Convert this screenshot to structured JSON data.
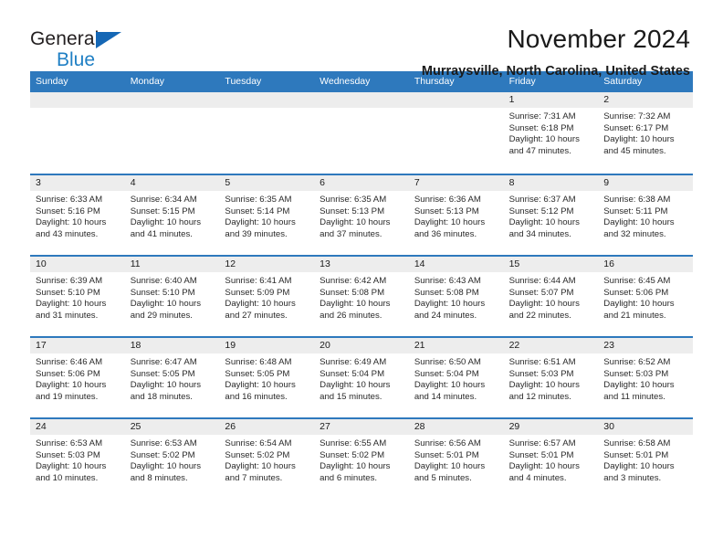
{
  "brand": {
    "line1": "General",
    "line2": "Blue",
    "triangle_color": "#1567b5",
    "blue_text_color": "#1f7fc4"
  },
  "header": {
    "title": "November 2024",
    "subtitle": "Murraysville, North Carolina, United States"
  },
  "theme": {
    "header_band_color": "#2e79bd",
    "day_band_color": "#ededed",
    "text_color": "#1a1a1a"
  },
  "weekdays": [
    "Sunday",
    "Monday",
    "Tuesday",
    "Wednesday",
    "Thursday",
    "Friday",
    "Saturday"
  ],
  "weeks": [
    [
      {
        "day": "",
        "empty": true,
        "sunrise": "",
        "sunset": "",
        "daylight_line1": "",
        "daylight_line2": ""
      },
      {
        "day": "",
        "empty": true,
        "sunrise": "",
        "sunset": "",
        "daylight_line1": "",
        "daylight_line2": ""
      },
      {
        "day": "",
        "empty": true,
        "sunrise": "",
        "sunset": "",
        "daylight_line1": "",
        "daylight_line2": ""
      },
      {
        "day": "",
        "empty": true,
        "sunrise": "",
        "sunset": "",
        "daylight_line1": "",
        "daylight_line2": ""
      },
      {
        "day": "",
        "empty": true,
        "sunrise": "",
        "sunset": "",
        "daylight_line1": "",
        "daylight_line2": ""
      },
      {
        "day": "1",
        "empty": false,
        "sunrise": "Sunrise: 7:31 AM",
        "sunset": "Sunset: 6:18 PM",
        "daylight_line1": "Daylight: 10 hours",
        "daylight_line2": "and 47 minutes."
      },
      {
        "day": "2",
        "empty": false,
        "sunrise": "Sunrise: 7:32 AM",
        "sunset": "Sunset: 6:17 PM",
        "daylight_line1": "Daylight: 10 hours",
        "daylight_line2": "and 45 minutes."
      }
    ],
    [
      {
        "day": "3",
        "empty": false,
        "sunrise": "Sunrise: 6:33 AM",
        "sunset": "Sunset: 5:16 PM",
        "daylight_line1": "Daylight: 10 hours",
        "daylight_line2": "and 43 minutes."
      },
      {
        "day": "4",
        "empty": false,
        "sunrise": "Sunrise: 6:34 AM",
        "sunset": "Sunset: 5:15 PM",
        "daylight_line1": "Daylight: 10 hours",
        "daylight_line2": "and 41 minutes."
      },
      {
        "day": "5",
        "empty": false,
        "sunrise": "Sunrise: 6:35 AM",
        "sunset": "Sunset: 5:14 PM",
        "daylight_line1": "Daylight: 10 hours",
        "daylight_line2": "and 39 minutes."
      },
      {
        "day": "6",
        "empty": false,
        "sunrise": "Sunrise: 6:35 AM",
        "sunset": "Sunset: 5:13 PM",
        "daylight_line1": "Daylight: 10 hours",
        "daylight_line2": "and 37 minutes."
      },
      {
        "day": "7",
        "empty": false,
        "sunrise": "Sunrise: 6:36 AM",
        "sunset": "Sunset: 5:13 PM",
        "daylight_line1": "Daylight: 10 hours",
        "daylight_line2": "and 36 minutes."
      },
      {
        "day": "8",
        "empty": false,
        "sunrise": "Sunrise: 6:37 AM",
        "sunset": "Sunset: 5:12 PM",
        "daylight_line1": "Daylight: 10 hours",
        "daylight_line2": "and 34 minutes."
      },
      {
        "day": "9",
        "empty": false,
        "sunrise": "Sunrise: 6:38 AM",
        "sunset": "Sunset: 5:11 PM",
        "daylight_line1": "Daylight: 10 hours",
        "daylight_line2": "and 32 minutes."
      }
    ],
    [
      {
        "day": "10",
        "empty": false,
        "sunrise": "Sunrise: 6:39 AM",
        "sunset": "Sunset: 5:10 PM",
        "daylight_line1": "Daylight: 10 hours",
        "daylight_line2": "and 31 minutes."
      },
      {
        "day": "11",
        "empty": false,
        "sunrise": "Sunrise: 6:40 AM",
        "sunset": "Sunset: 5:10 PM",
        "daylight_line1": "Daylight: 10 hours",
        "daylight_line2": "and 29 minutes."
      },
      {
        "day": "12",
        "empty": false,
        "sunrise": "Sunrise: 6:41 AM",
        "sunset": "Sunset: 5:09 PM",
        "daylight_line1": "Daylight: 10 hours",
        "daylight_line2": "and 27 minutes."
      },
      {
        "day": "13",
        "empty": false,
        "sunrise": "Sunrise: 6:42 AM",
        "sunset": "Sunset: 5:08 PM",
        "daylight_line1": "Daylight: 10 hours",
        "daylight_line2": "and 26 minutes."
      },
      {
        "day": "14",
        "empty": false,
        "sunrise": "Sunrise: 6:43 AM",
        "sunset": "Sunset: 5:08 PM",
        "daylight_line1": "Daylight: 10 hours",
        "daylight_line2": "and 24 minutes."
      },
      {
        "day": "15",
        "empty": false,
        "sunrise": "Sunrise: 6:44 AM",
        "sunset": "Sunset: 5:07 PM",
        "daylight_line1": "Daylight: 10 hours",
        "daylight_line2": "and 22 minutes."
      },
      {
        "day": "16",
        "empty": false,
        "sunrise": "Sunrise: 6:45 AM",
        "sunset": "Sunset: 5:06 PM",
        "daylight_line1": "Daylight: 10 hours",
        "daylight_line2": "and 21 minutes."
      }
    ],
    [
      {
        "day": "17",
        "empty": false,
        "sunrise": "Sunrise: 6:46 AM",
        "sunset": "Sunset: 5:06 PM",
        "daylight_line1": "Daylight: 10 hours",
        "daylight_line2": "and 19 minutes."
      },
      {
        "day": "18",
        "empty": false,
        "sunrise": "Sunrise: 6:47 AM",
        "sunset": "Sunset: 5:05 PM",
        "daylight_line1": "Daylight: 10 hours",
        "daylight_line2": "and 18 minutes."
      },
      {
        "day": "19",
        "empty": false,
        "sunrise": "Sunrise: 6:48 AM",
        "sunset": "Sunset: 5:05 PM",
        "daylight_line1": "Daylight: 10 hours",
        "daylight_line2": "and 16 minutes."
      },
      {
        "day": "20",
        "empty": false,
        "sunrise": "Sunrise: 6:49 AM",
        "sunset": "Sunset: 5:04 PM",
        "daylight_line1": "Daylight: 10 hours",
        "daylight_line2": "and 15 minutes."
      },
      {
        "day": "21",
        "empty": false,
        "sunrise": "Sunrise: 6:50 AM",
        "sunset": "Sunset: 5:04 PM",
        "daylight_line1": "Daylight: 10 hours",
        "daylight_line2": "and 14 minutes."
      },
      {
        "day": "22",
        "empty": false,
        "sunrise": "Sunrise: 6:51 AM",
        "sunset": "Sunset: 5:03 PM",
        "daylight_line1": "Daylight: 10 hours",
        "daylight_line2": "and 12 minutes."
      },
      {
        "day": "23",
        "empty": false,
        "sunrise": "Sunrise: 6:52 AM",
        "sunset": "Sunset: 5:03 PM",
        "daylight_line1": "Daylight: 10 hours",
        "daylight_line2": "and 11 minutes."
      }
    ],
    [
      {
        "day": "24",
        "empty": false,
        "sunrise": "Sunrise: 6:53 AM",
        "sunset": "Sunset: 5:03 PM",
        "daylight_line1": "Daylight: 10 hours",
        "daylight_line2": "and 10 minutes."
      },
      {
        "day": "25",
        "empty": false,
        "sunrise": "Sunrise: 6:53 AM",
        "sunset": "Sunset: 5:02 PM",
        "daylight_line1": "Daylight: 10 hours",
        "daylight_line2": "and 8 minutes."
      },
      {
        "day": "26",
        "empty": false,
        "sunrise": "Sunrise: 6:54 AM",
        "sunset": "Sunset: 5:02 PM",
        "daylight_line1": "Daylight: 10 hours",
        "daylight_line2": "and 7 minutes."
      },
      {
        "day": "27",
        "empty": false,
        "sunrise": "Sunrise: 6:55 AM",
        "sunset": "Sunset: 5:02 PM",
        "daylight_line1": "Daylight: 10 hours",
        "daylight_line2": "and 6 minutes."
      },
      {
        "day": "28",
        "empty": false,
        "sunrise": "Sunrise: 6:56 AM",
        "sunset": "Sunset: 5:01 PM",
        "daylight_line1": "Daylight: 10 hours",
        "daylight_line2": "and 5 minutes."
      },
      {
        "day": "29",
        "empty": false,
        "sunrise": "Sunrise: 6:57 AM",
        "sunset": "Sunset: 5:01 PM",
        "daylight_line1": "Daylight: 10 hours",
        "daylight_line2": "and 4 minutes."
      },
      {
        "day": "30",
        "empty": false,
        "sunrise": "Sunrise: 6:58 AM",
        "sunset": "Sunset: 5:01 PM",
        "daylight_line1": "Daylight: 10 hours",
        "daylight_line2": "and 3 minutes."
      }
    ]
  ]
}
